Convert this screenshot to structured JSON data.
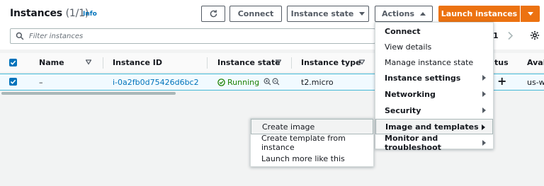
{
  "header": {
    "title": "Instances",
    "count": "(1/1)",
    "info": "Info"
  },
  "toolbar": {
    "connect_label": "Connect",
    "instance_state_label": "Instance state",
    "actions_label": "Actions",
    "launch_label": "Launch instances"
  },
  "search": {
    "placeholder": "Filter instances"
  },
  "pagination": {
    "page": "1"
  },
  "table": {
    "columns": [
      "Name",
      "Instance ID",
      "Instance state",
      "Instance type",
      "tus",
      "Avail"
    ],
    "rows": [
      {
        "name": "–",
        "instance_id": "i-0a2fb0d75426d6bc2",
        "state": "Running",
        "type": "t2.micro",
        "availability": "us-w"
      }
    ]
  },
  "actions_menu": {
    "items": [
      {
        "label": "Connect",
        "submenu": false
      },
      {
        "label": "View details",
        "submenu": false
      },
      {
        "label": "Manage instance state",
        "submenu": false
      },
      {
        "label": "Instance settings",
        "submenu": true
      },
      {
        "label": "Networking",
        "submenu": true
      },
      {
        "label": "Security",
        "submenu": true
      },
      {
        "label": "Image and templates",
        "submenu": true
      },
      {
        "label": "Monitor and troubleshoot",
        "submenu": true
      }
    ]
  },
  "image_submenu": {
    "items": [
      "Create image",
      "Create template from instance",
      "Launch more like this"
    ]
  },
  "colors": {
    "accent": "#0073bb",
    "launch": "#ec7211",
    "running": "#1d8102"
  }
}
